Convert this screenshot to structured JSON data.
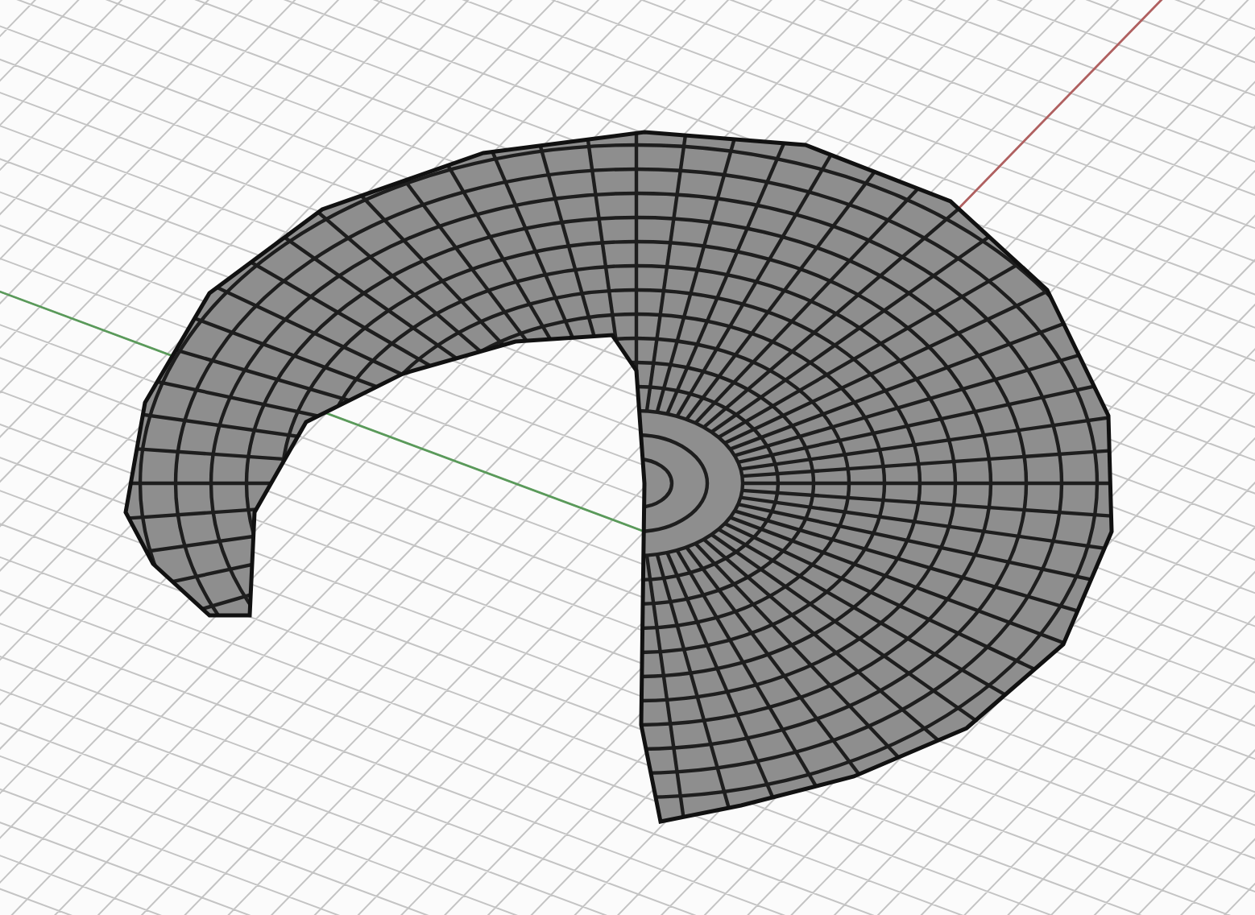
{
  "viewport": {
    "axes": [
      {
        "kind": "x",
        "color": "#b06060"
      },
      {
        "kind": "y",
        "color": "#5a9a5a"
      }
    ]
  }
}
